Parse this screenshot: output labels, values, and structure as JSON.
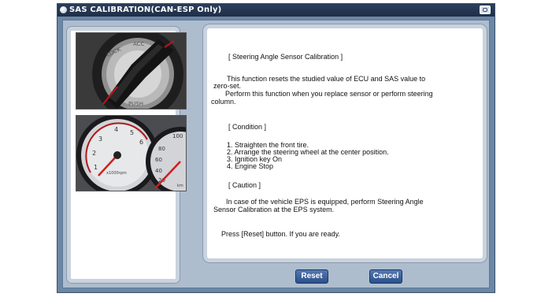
{
  "window": {
    "title": "SAS CALIBRATION(CAN-ESP Only)"
  },
  "images": {
    "ignition": {
      "knob_text_top": "LOCK  ACC  ON  START",
      "knob_text_bottom": "PUSH"
    },
    "gauges": {
      "tach_labels": [
        "1",
        "2",
        "3",
        "4",
        "5",
        "6"
      ],
      "tach_unit": "x1000rpm",
      "temp_labels": [
        "80",
        "60",
        "40",
        "20",
        "100"
      ],
      "temp_unit": "km"
    }
  },
  "instructions": {
    "heading": "[ Steering Angle Sensor Calibration ]",
    "intro_line1": "This function resets the studied value of ECU and SAS value to",
    "intro_line2": "zero-set.",
    "intro_line3": "Perform this function when you replace sensor or perform steering",
    "intro_line4": "column.",
    "condition_heading": "[ Condition ]",
    "conditions": [
      "1. Straighten the front tire.",
      "2. Arrange the steering wheel at the center position.",
      "3. Ignition key On",
      "4. Engine Stop"
    ],
    "caution_heading": "[ Caution ]",
    "caution_line1": "In case of the vehicle EPS is equipped, perform Steering Angle",
    "caution_line2": "Sensor Calibration at the EPS system.",
    "prompt": "Press [Reset] button. If you are ready."
  },
  "buttons": {
    "reset": "Reset",
    "cancel": "Cancel"
  }
}
